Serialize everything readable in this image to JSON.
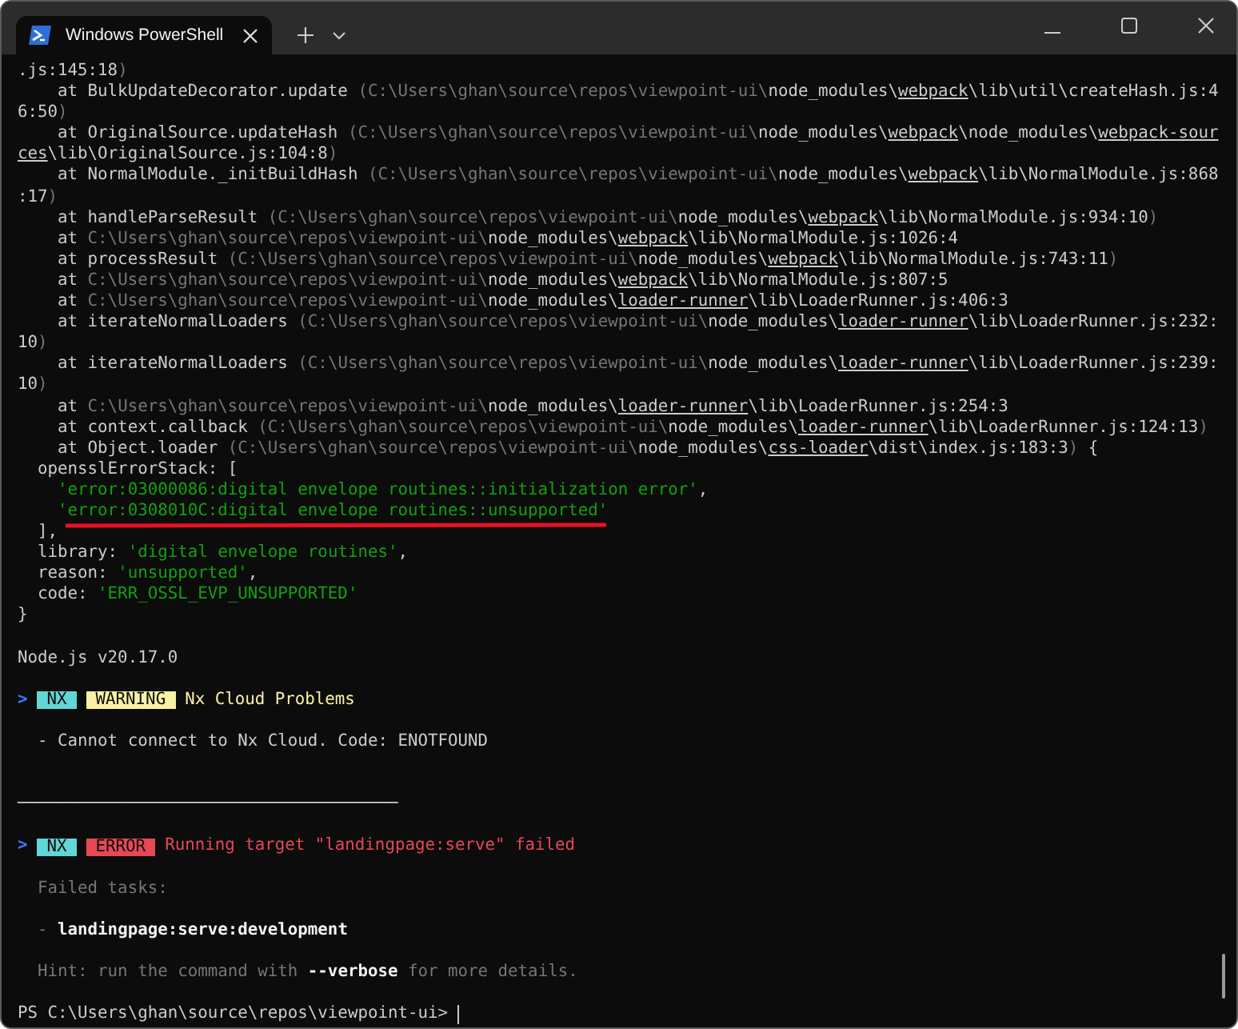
{
  "window": {
    "tab": {
      "title": "Windows PowerShell",
      "selected": true
    }
  },
  "lines": [
    {
      "kind": "log",
      "segments": [
        {
          "kind": "plain",
          "text": ".js:145:18"
        },
        {
          "kind": "dim",
          "text": ")"
        }
      ]
    },
    {
      "kind": "log",
      "segments": [
        {
          "kind": "plain",
          "text": "    at BulkUpdateDecorator.update "
        },
        {
          "kind": "dim",
          "text": "(C:\\Users\\ghan\\source\\repos\\viewpoint-ui\\"
        },
        {
          "kind": "plain",
          "text": "node_modules\\"
        },
        {
          "kind": "link",
          "text": "webpack"
        },
        {
          "kind": "plain",
          "text": "\\lib\\util\\createHash.js:4"
        }
      ]
    },
    {
      "kind": "log",
      "segments": [
        {
          "kind": "plain",
          "text": "6:50"
        },
        {
          "kind": "dim",
          "text": ")"
        }
      ]
    },
    {
      "kind": "log",
      "segments": [
        {
          "kind": "plain",
          "text": "    at OriginalSource.updateHash "
        },
        {
          "kind": "dim",
          "text": "(C:\\Users\\ghan\\source\\repos\\viewpoint-ui\\"
        },
        {
          "kind": "plain",
          "text": "node_modules\\"
        },
        {
          "kind": "link",
          "text": "webpack"
        },
        {
          "kind": "plain",
          "text": "\\node_modules\\"
        },
        {
          "kind": "link",
          "text": "webpack-sour"
        }
      ]
    },
    {
      "kind": "log",
      "segments": [
        {
          "kind": "link",
          "text": "ces"
        },
        {
          "kind": "plain",
          "text": "\\lib\\OriginalSource.js:104:8"
        },
        {
          "kind": "dim",
          "text": ")"
        }
      ]
    },
    {
      "kind": "log",
      "segments": [
        {
          "kind": "plain",
          "text": "    at NormalModule._initBuildHash "
        },
        {
          "kind": "dim",
          "text": "(C:\\Users\\ghan\\source\\repos\\viewpoint-ui\\"
        },
        {
          "kind": "plain",
          "text": "node_modules\\"
        },
        {
          "kind": "link",
          "text": "webpack"
        },
        {
          "kind": "plain",
          "text": "\\lib\\NormalModule.js:868"
        }
      ]
    },
    {
      "kind": "log",
      "segments": [
        {
          "kind": "plain",
          "text": ":17"
        },
        {
          "kind": "dim",
          "text": ")"
        }
      ]
    },
    {
      "kind": "log",
      "segments": [
        {
          "kind": "plain",
          "text": "    at handleParseResult "
        },
        {
          "kind": "dim",
          "text": "(C:\\Users\\ghan\\source\\repos\\viewpoint-ui\\"
        },
        {
          "kind": "plain",
          "text": "node_modules\\"
        },
        {
          "kind": "link",
          "text": "webpack"
        },
        {
          "kind": "plain",
          "text": "\\lib\\NormalModule.js:934:10"
        },
        {
          "kind": "dim",
          "text": ")"
        }
      ]
    },
    {
      "kind": "log",
      "segments": [
        {
          "kind": "plain",
          "text": "    at "
        },
        {
          "kind": "dim",
          "text": "C:\\Users\\ghan\\source\\repos\\viewpoint-ui\\"
        },
        {
          "kind": "plain",
          "text": "node_modules\\"
        },
        {
          "kind": "link",
          "text": "webpack"
        },
        {
          "kind": "plain",
          "text": "\\lib\\NormalModule.js:1026:4"
        }
      ]
    },
    {
      "kind": "log",
      "segments": [
        {
          "kind": "plain",
          "text": "    at processResult "
        },
        {
          "kind": "dim",
          "text": "(C:\\Users\\ghan\\source\\repos\\viewpoint-ui\\"
        },
        {
          "kind": "plain",
          "text": "node_modules\\"
        },
        {
          "kind": "link",
          "text": "webpack"
        },
        {
          "kind": "plain",
          "text": "\\lib\\NormalModule.js:743:11"
        },
        {
          "kind": "dim",
          "text": ")"
        }
      ]
    },
    {
      "kind": "log",
      "segments": [
        {
          "kind": "plain",
          "text": "    at "
        },
        {
          "kind": "dim",
          "text": "C:\\Users\\ghan\\source\\repos\\viewpoint-ui\\"
        },
        {
          "kind": "plain",
          "text": "node_modules\\"
        },
        {
          "kind": "link",
          "text": "webpack"
        },
        {
          "kind": "plain",
          "text": "\\lib\\NormalModule.js:807:5"
        }
      ]
    },
    {
      "kind": "log",
      "segments": [
        {
          "kind": "plain",
          "text": "    at "
        },
        {
          "kind": "dim",
          "text": "C:\\Users\\ghan\\source\\repos\\viewpoint-ui\\"
        },
        {
          "kind": "plain",
          "text": "node_modules\\"
        },
        {
          "kind": "link",
          "text": "loader-runner"
        },
        {
          "kind": "plain",
          "text": "\\lib\\LoaderRunner.js:406:3"
        }
      ]
    },
    {
      "kind": "log",
      "segments": [
        {
          "kind": "plain",
          "text": "    at iterateNormalLoaders "
        },
        {
          "kind": "dim",
          "text": "(C:\\Users\\ghan\\source\\repos\\viewpoint-ui\\"
        },
        {
          "kind": "plain",
          "text": "node_modules\\"
        },
        {
          "kind": "link",
          "text": "loader-runner"
        },
        {
          "kind": "plain",
          "text": "\\lib\\LoaderRunner.js:232:"
        }
      ]
    },
    {
      "kind": "log",
      "segments": [
        {
          "kind": "plain",
          "text": "10"
        },
        {
          "kind": "dim",
          "text": ")"
        }
      ]
    },
    {
      "kind": "log",
      "segments": [
        {
          "kind": "plain",
          "text": "    at iterateNormalLoaders "
        },
        {
          "kind": "dim",
          "text": "(C:\\Users\\ghan\\source\\repos\\viewpoint-ui\\"
        },
        {
          "kind": "plain",
          "text": "node_modules\\"
        },
        {
          "kind": "link",
          "text": "loader-runner"
        },
        {
          "kind": "plain",
          "text": "\\lib\\LoaderRunner.js:239:"
        }
      ]
    },
    {
      "kind": "log",
      "segments": [
        {
          "kind": "plain",
          "text": "10"
        },
        {
          "kind": "dim",
          "text": ")"
        }
      ]
    },
    {
      "kind": "log",
      "segments": [
        {
          "kind": "plain",
          "text": "    at "
        },
        {
          "kind": "dim",
          "text": "C:\\Users\\ghan\\source\\repos\\viewpoint-ui\\"
        },
        {
          "kind": "plain",
          "text": "node_modules\\"
        },
        {
          "kind": "link",
          "text": "loader-runner"
        },
        {
          "kind": "plain",
          "text": "\\lib\\LoaderRunner.js:254:3"
        }
      ]
    },
    {
      "kind": "log",
      "segments": [
        {
          "kind": "plain",
          "text": "    at context.callback "
        },
        {
          "kind": "dim",
          "text": "(C:\\Users\\ghan\\source\\repos\\viewpoint-ui\\"
        },
        {
          "kind": "plain",
          "text": "node_modules\\"
        },
        {
          "kind": "link",
          "text": "loader-runner"
        },
        {
          "kind": "plain",
          "text": "\\lib\\LoaderRunner.js:124:13"
        },
        {
          "kind": "dim",
          "text": ")"
        }
      ]
    },
    {
      "kind": "log",
      "segments": [
        {
          "kind": "plain",
          "text": "    at Object.loader "
        },
        {
          "kind": "dim",
          "text": "(C:\\Users\\ghan\\source\\repos\\viewpoint-ui\\"
        },
        {
          "kind": "plain",
          "text": "node_modules\\"
        },
        {
          "kind": "link",
          "text": "css-loader"
        },
        {
          "kind": "plain",
          "text": "\\dist\\index.js:183:3"
        },
        {
          "kind": "dim",
          "text": ")"
        },
        {
          "kind": "plain",
          "text": " {"
        }
      ]
    },
    {
      "kind": "log",
      "segments": [
        {
          "kind": "plain",
          "text": "  opensslErrorStack: ["
        }
      ]
    },
    {
      "kind": "log",
      "segments": [
        {
          "kind": "string",
          "text": "    'error:03000086:digital envelope routines::initialization error'"
        },
        {
          "kind": "plain",
          "text": ","
        }
      ]
    },
    {
      "kind": "log",
      "underlined": true,
      "segments": [
        {
          "kind": "string",
          "text": "    'error:0308010C:digital envelope routines::unsupported'"
        }
      ]
    },
    {
      "kind": "log",
      "segments": [
        {
          "kind": "plain",
          "text": "  ],"
        }
      ]
    },
    {
      "kind": "log",
      "segments": [
        {
          "kind": "plain",
          "text": "  library: "
        },
        {
          "kind": "string",
          "text": "'digital envelope routines'"
        },
        {
          "kind": "plain",
          "text": ","
        }
      ]
    },
    {
      "kind": "log",
      "segments": [
        {
          "kind": "plain",
          "text": "  reason: "
        },
        {
          "kind": "string",
          "text": "'unsupported'"
        },
        {
          "kind": "plain",
          "text": ","
        }
      ]
    },
    {
      "kind": "log",
      "segments": [
        {
          "kind": "plain",
          "text": "  code: "
        },
        {
          "kind": "string",
          "text": "'ERR_OSSL_EVP_UNSUPPORTED'"
        }
      ]
    },
    {
      "kind": "log",
      "segments": [
        {
          "kind": "plain",
          "text": "}"
        }
      ]
    },
    {
      "kind": "blank"
    },
    {
      "kind": "log",
      "segments": [
        {
          "kind": "plain",
          "text": "Node.js v20.17.0"
        }
      ]
    },
    {
      "kind": "blank"
    },
    {
      "kind": "tagged",
      "segments": [
        {
          "kind": "prompt",
          "text": ">"
        },
        {
          "kind": "badge",
          "text": "NX",
          "color": "#61d6d6"
        },
        {
          "kind": "badge",
          "text": "WARNING",
          "color": "#f9f1a5"
        },
        {
          "kind": "message",
          "text": "Nx Cloud Problems",
          "color": "#f9f1a5"
        }
      ]
    },
    {
      "kind": "blank"
    },
    {
      "kind": "log",
      "segments": [
        {
          "kind": "plain",
          "text": "  - Cannot connect to Nx Cloud. Code: ENOTFOUND"
        }
      ]
    },
    {
      "kind": "blank"
    },
    {
      "kind": "blank"
    },
    {
      "kind": "log",
      "segments": [
        {
          "kind": "plain",
          "text": "──────────────────────────────────────"
        }
      ]
    },
    {
      "kind": "blank"
    },
    {
      "kind": "tagged",
      "segments": [
        {
          "kind": "prompt",
          "text": ">"
        },
        {
          "kind": "badge",
          "text": "NX",
          "color": "#61d6d6"
        },
        {
          "kind": "badge",
          "text": "ERROR",
          "color": "#e74856"
        },
        {
          "kind": "message",
          "text": "Running target \"landingpage:serve\" failed",
          "color": "#e74856"
        }
      ]
    },
    {
      "kind": "blank"
    },
    {
      "kind": "log",
      "segments": [
        {
          "kind": "dim",
          "text": "  Failed tasks:"
        }
      ]
    },
    {
      "kind": "blank"
    },
    {
      "kind": "log",
      "segments": [
        {
          "kind": "dim",
          "text": "  - "
        },
        {
          "kind": "bold",
          "text": "landingpage:serve:development"
        }
      ]
    },
    {
      "kind": "blank"
    },
    {
      "kind": "log",
      "segments": [
        {
          "kind": "dim",
          "text": "  Hint: run the command with "
        },
        {
          "kind": "bold",
          "text": "--verbose"
        },
        {
          "kind": "dim",
          "text": " for more details."
        }
      ]
    },
    {
      "kind": "blank"
    }
  ],
  "prompt": "PS C:\\Users\\ghan\\source\\repos\\viewpoint-ui> "
}
